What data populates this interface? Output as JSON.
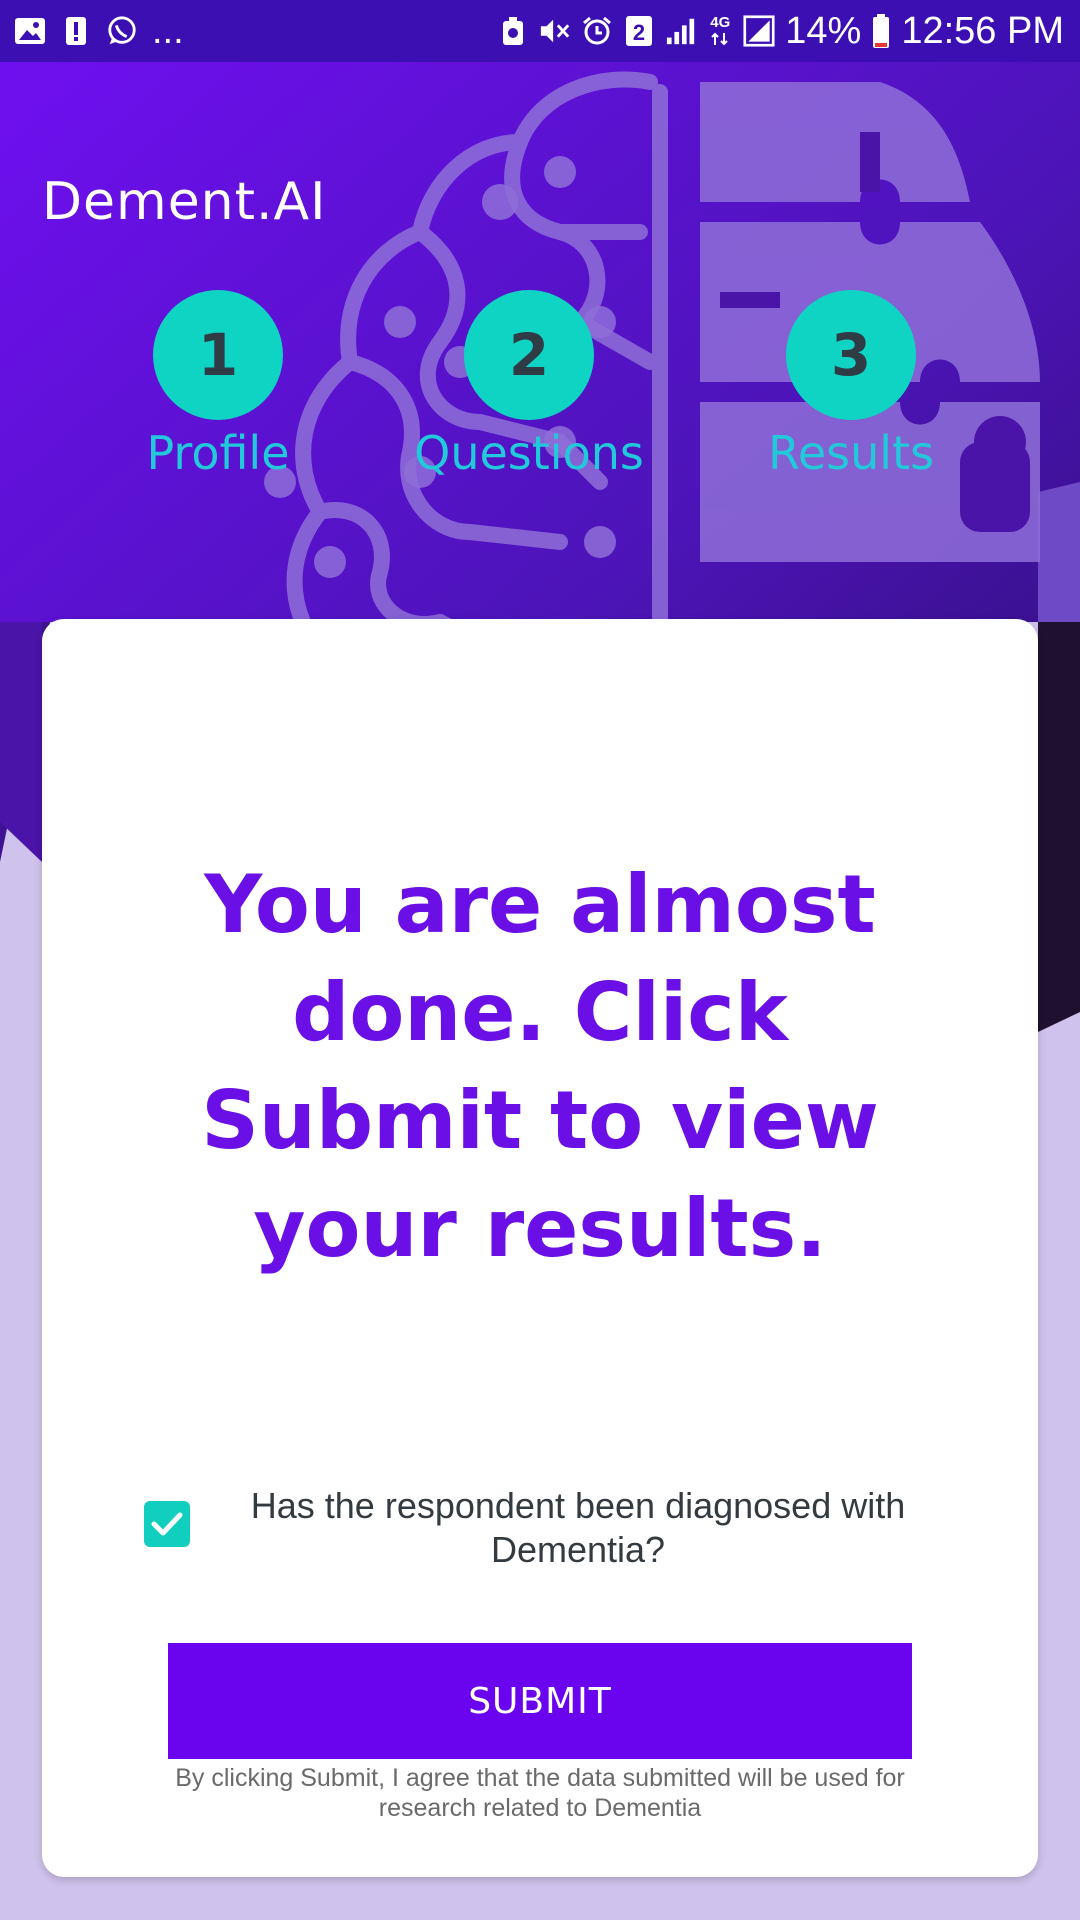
{
  "status_bar": {
    "notification_more": "...",
    "sim_badge": "2",
    "network_type": "4G",
    "battery_percent": "14%",
    "time": "12:56 PM",
    "left_icons": [
      "gallery-icon",
      "alert-icon",
      "whatsapp-icon"
    ],
    "right_icons": [
      "accessibility-icon",
      "mute-icon",
      "alarm-icon",
      "sim2-icon",
      "signal-icon",
      "data-arrows-icon",
      "signal-box-icon",
      "battery-icon"
    ]
  },
  "app": {
    "title": "Dement.AI"
  },
  "steps": [
    {
      "number": "1",
      "label": "Profile"
    },
    {
      "number": "2",
      "label": "Questions"
    },
    {
      "number": "3",
      "label": "Results"
    }
  ],
  "card": {
    "headline": "You are almost done. Click Submit to view your results.",
    "question": "Has the respondent been diagnosed with Dementia?",
    "checkbox_checked": true,
    "submit_label": "SUBMIT",
    "disclaimer": "By clicking Submit, I agree that the data submitted will be used for research related to Dementia"
  },
  "colors": {
    "primary": "#6a03ee",
    "accent": "#0fd3c3",
    "step_label": "#22c9da",
    "background": "#cfc2ec"
  }
}
